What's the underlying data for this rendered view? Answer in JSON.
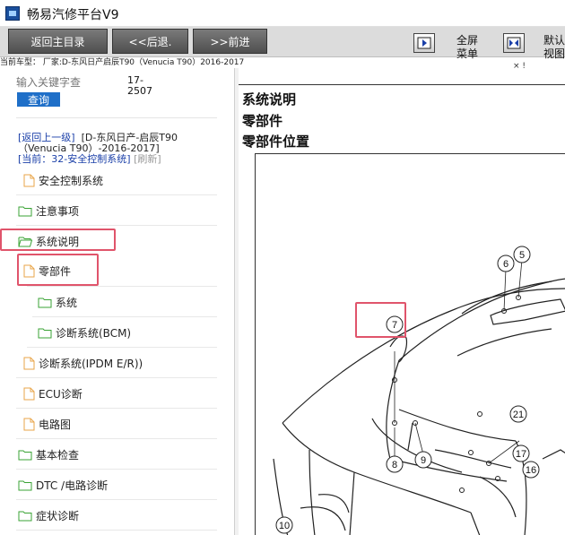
{
  "window": {
    "title": "畅易汽修平台V9"
  },
  "toolbar": {
    "home_label": "返回主目录",
    "back_label": "<<后退.",
    "forward_label": ">>前进",
    "fullscreen_label_1": "全屏",
    "fullscreen_label_2": "菜单",
    "default_label_1": "默认",
    "default_label_2": "视图"
  },
  "car": {
    "line": "当前车型： 厂家:D-东风日产启辰T90（Venucia T90）2016-2017"
  },
  "search": {
    "placeholder": "输入关键字查",
    "button_label": "查询",
    "side_1": "17-",
    "side_2": "2507"
  },
  "nav": {
    "back_up": "[返回上一级]",
    "path_1": "[D-东风日产-启辰T90",
    "path_2": "（Venucia T90）-2016-2017]",
    "current": "[当前：32-安全控制系统]",
    "refresh": "[刷新]"
  },
  "tree": {
    "items": [
      {
        "label": "安全控制系统",
        "icon": "document-icon"
      },
      {
        "label": "注意事项",
        "icon": "folder-icon"
      },
      {
        "label": "系统说明",
        "icon": "folder-open-icon"
      },
      {
        "label": "零部件",
        "icon": "document-icon"
      },
      {
        "label": "系统",
        "icon": "folder-icon"
      },
      {
        "label": "诊断系统(BCM)",
        "icon": "folder-icon"
      },
      {
        "label": "诊断系统(IPDM E/R))",
        "icon": "document-icon"
      },
      {
        "label": "ECU诊断",
        "icon": "document-icon"
      },
      {
        "label": "电路图",
        "icon": "document-icon"
      },
      {
        "label": "基本检查",
        "icon": "folder-icon"
      },
      {
        "label": "DTC /电路诊断",
        "icon": "folder-icon"
      },
      {
        "label": "症状诊断",
        "icon": "folder-icon"
      }
    ]
  },
  "content": {
    "mark": "×  !",
    "heading_1": "系统说明",
    "heading_2": "零部件",
    "heading_3": "零部件位置"
  },
  "diagram": {
    "callouts": [
      "5",
      "6",
      "7",
      "21",
      "17",
      "16",
      "8",
      "9",
      "10"
    ]
  },
  "colors": {
    "highlight": "#e0546b",
    "button_blue": "#1f6fc8",
    "link_blue": "#1a3fa8",
    "folder_green": "#3aa335",
    "doc_orange": "#e9a64a"
  }
}
